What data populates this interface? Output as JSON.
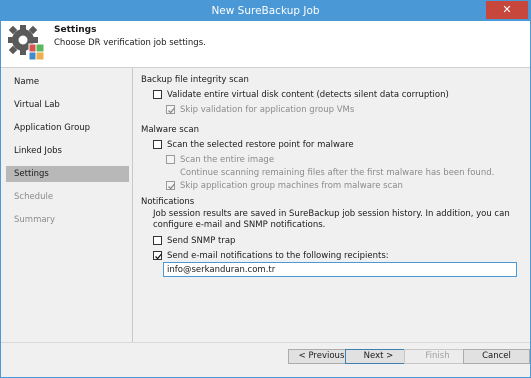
{
  "window": {
    "title": "New SureBackup Job",
    "close_glyph": "✕"
  },
  "header": {
    "title": "Settings",
    "subtitle": "Choose DR verification job settings.",
    "icon": "gear-settings-icon"
  },
  "sidebar": {
    "items": [
      {
        "label": "Name",
        "state": "normal"
      },
      {
        "label": "Virtual Lab",
        "state": "normal"
      },
      {
        "label": "Application Group",
        "state": "normal"
      },
      {
        "label": "Linked Jobs",
        "state": "normal"
      },
      {
        "label": "Settings",
        "state": "active"
      },
      {
        "label": "Schedule",
        "state": "disabled"
      },
      {
        "label": "Summary",
        "state": "disabled"
      }
    ]
  },
  "integrity": {
    "heading": "Backup file integrity scan",
    "validate_label": "Validate entire virtual disk content (detects silent data corruption)",
    "validate_checked": false,
    "skip_label": "Skip validation for application group VMs",
    "skip_checked": true
  },
  "malware": {
    "heading": "Malware scan",
    "scan_label": "Scan the selected restore point for malware",
    "scan_checked": false,
    "entire_label": "Scan the entire image",
    "entire_checked": false,
    "continue_label": "Continue scanning remaining files after the first malware has been found.",
    "skip_app_label": "Skip application group machines from malware scan",
    "skip_app_checked": true
  },
  "notifications": {
    "heading": "Notifications",
    "description": "Job session results are saved in SureBackup job session history. In addition, you can configure e-mail and SNMP notifications.",
    "snmp_label": "Send SNMP trap",
    "snmp_checked": false,
    "email_label": "Send e-mail notifications to the following recipients:",
    "email_checked": true,
    "email_value": "info@serkanduran.com.tr"
  },
  "buttons": {
    "previous": "< Previous",
    "next": "Next >",
    "finish": "Finish",
    "cancel": "Cancel"
  },
  "colors": {
    "accent": "#4a98d6",
    "close": "#c8473c",
    "active_nav": "#b8b8b8"
  }
}
